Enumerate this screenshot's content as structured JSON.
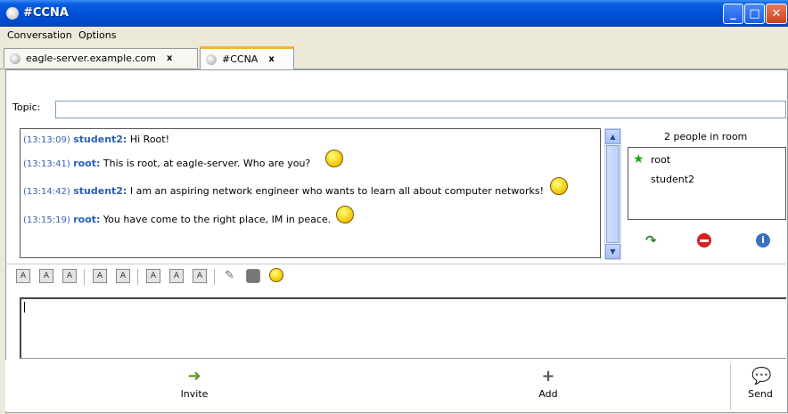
{
  "window": {
    "title": "#CCNA"
  },
  "menu": [
    {
      "label": "Conversation",
      "accel": "C"
    },
    {
      "label": "Options",
      "accel": "O"
    }
  ],
  "tabs": [
    {
      "label": "eagle-server.example.com",
      "close": "x",
      "active": false
    },
    {
      "label": "#CCNA",
      "close": "x",
      "active": true
    }
  ],
  "topic": {
    "label": "Topic:",
    "value": ""
  },
  "messages": [
    {
      "time": "(13:13:09)",
      "nick": "student2:",
      "text": "Hi Root!",
      "emote": ""
    },
    {
      "time": "(13:13:41)",
      "nick": "root:",
      "text": "This is root, at eagle-server. Who are you?",
      "emote": "cool-smiley"
    },
    {
      "time": "(13:14:42)",
      "nick": "student2:",
      "text": "I am an aspiring network engineer who wants to learn all about computer networks!",
      "emote": "grin-smiley"
    },
    {
      "time": "(13:15:19)",
      "nick": "root:",
      "text": "You have come to the right place, IM in peace.",
      "emote": "angel-smiley"
    }
  ],
  "people": {
    "count_label": "2 people in room",
    "list": [
      {
        "name": "root",
        "op": true
      },
      {
        "name": "student2",
        "op": false
      }
    ]
  },
  "actions": {
    "invite": "Invite",
    "add": "Add",
    "send": "Send"
  },
  "colors": {
    "nick": "#2a5fb5",
    "timestamp": "#3a5fb0",
    "titlebar": "#0050d8"
  }
}
